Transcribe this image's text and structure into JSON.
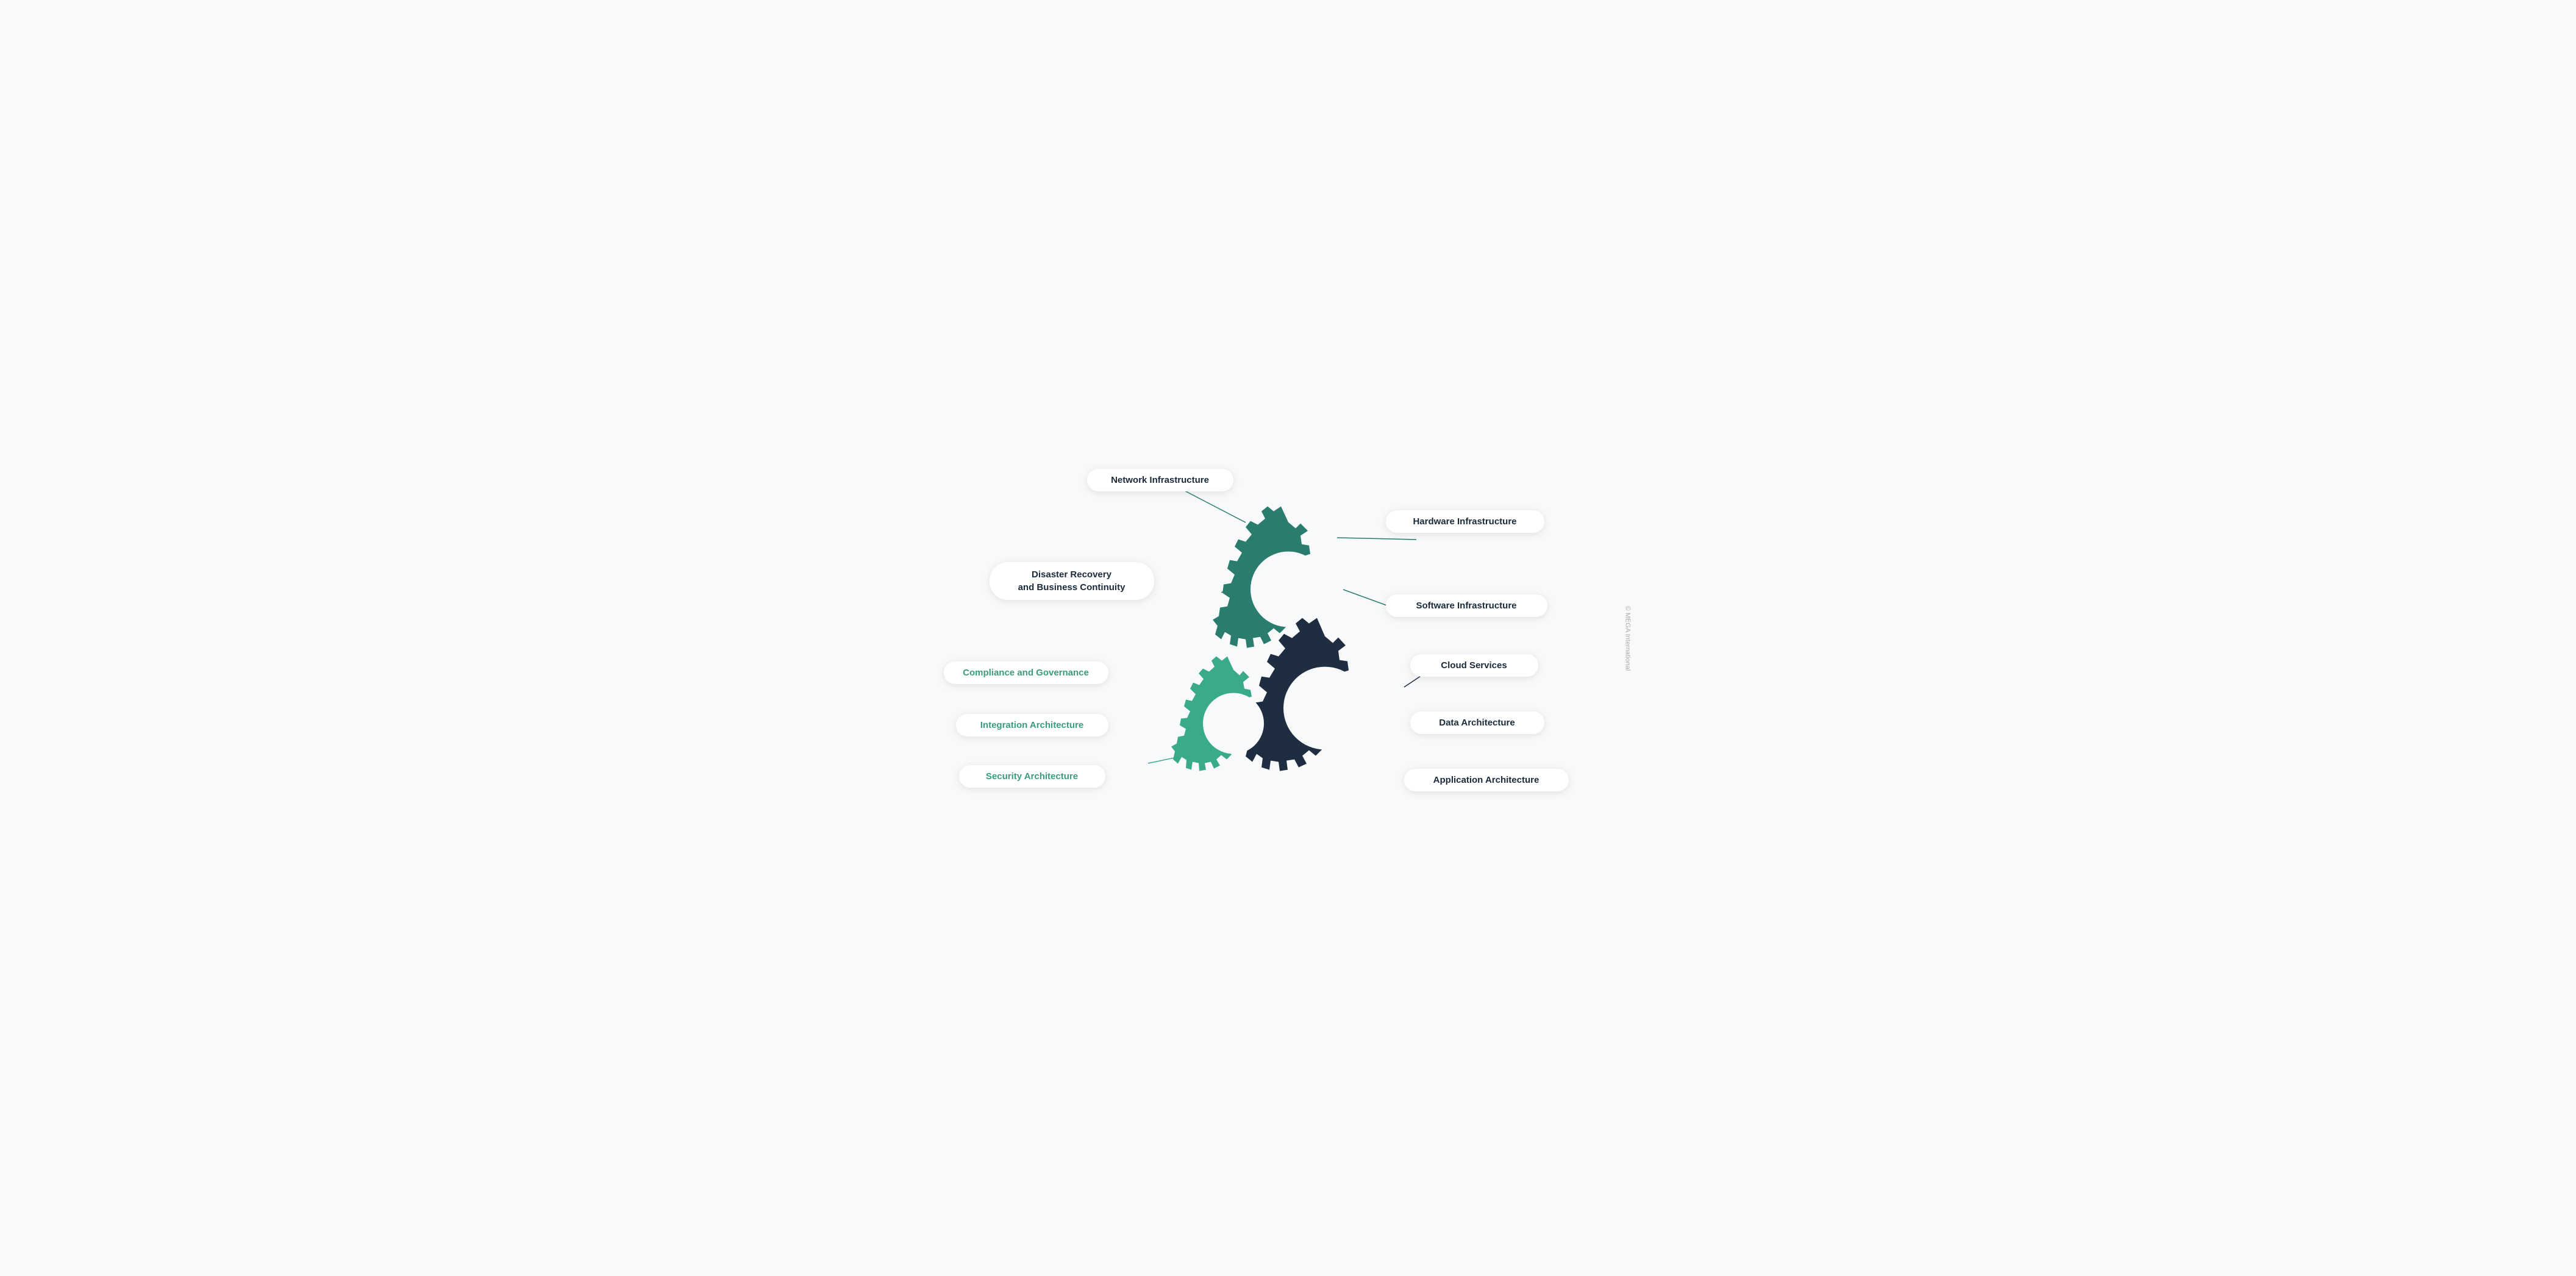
{
  "labels": {
    "network_infrastructure": "Network Infrastructure",
    "hardware_infrastructure": "Hardware Infrastructure",
    "software_infrastructure": "Software Infrastructure",
    "cloud_services": "Cloud Services",
    "data_architecture": "Data Architecture",
    "application_architecture": "Application Architecture",
    "disaster_recovery": "Disaster Recovery\nand Business Continuity",
    "compliance_governance": "Compliance and Governance",
    "integration_architecture": "Integration Architecture",
    "security_architecture": "Security Architecture"
  },
  "watermark": "© MEGA International",
  "colors": {
    "teal_dark": "#2a7d6e",
    "teal_mid": "#3aab8a",
    "navy": "#1e2d40",
    "line_teal": "#2a7d6e",
    "line_navy": "#1e2d40",
    "green_label": "#3a9b7f",
    "bg": "#f8f9fa"
  }
}
